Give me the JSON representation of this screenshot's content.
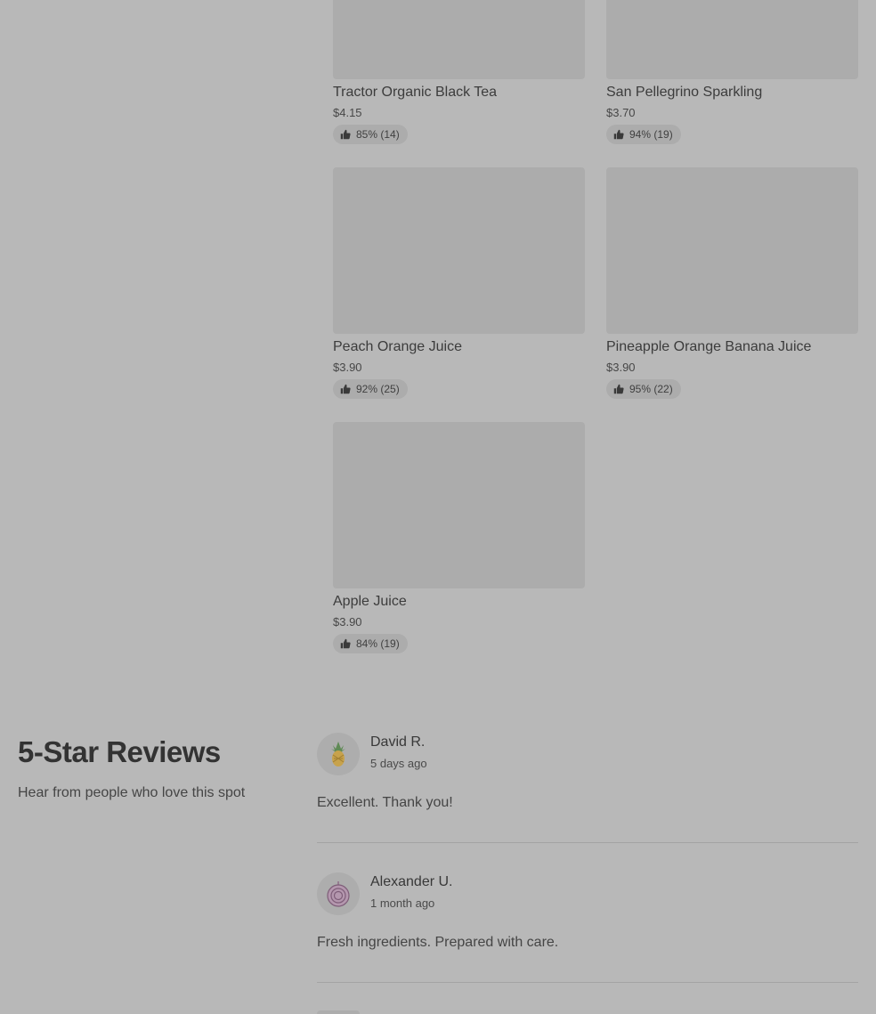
{
  "menu_items": [
    {
      "name": "Tractor Organic Black Tea",
      "price": "$4.15",
      "rating": "85% (14)"
    },
    {
      "name": "San Pellegrino Sparkling",
      "price": "$3.70",
      "rating": "94% (19)"
    },
    {
      "name": "Peach Orange Juice",
      "price": "$3.90",
      "rating": "92% (25)"
    },
    {
      "name": "Pineapple Orange Banana Juice",
      "price": "$3.90",
      "rating": "95% (22)"
    },
    {
      "name": "Apple Juice",
      "price": "$3.90",
      "rating": "84% (19)"
    }
  ],
  "rating_icon": "thumbs-up-icon",
  "reviews_section": {
    "title": "5-Star Reviews",
    "subtitle": "Hear from people who love this spot"
  },
  "reviews": [
    {
      "author": "David R.",
      "date": "5 days ago",
      "text": "Excellent. Thank you!",
      "avatar_icon": "pineapple-icon"
    },
    {
      "author": "Alexander U.",
      "date": "1 month ago",
      "text": "Fresh ingredients. Prepared with care.",
      "avatar_icon": "onion-icon"
    }
  ],
  "colors": {
    "background": "#b8b8b8",
    "placeholder": "#acacac",
    "divider": "#a3a3a3"
  }
}
